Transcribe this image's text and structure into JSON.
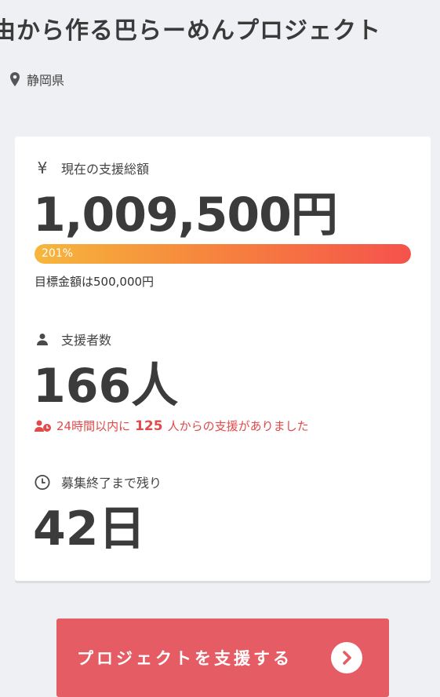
{
  "project": {
    "title": "由から作る巴らーめんプロジェクト",
    "location": "静岡県"
  },
  "stats": {
    "amount_label": "現在の支援総額",
    "amount_value": "1,009,500円",
    "progress_percent_text": "201%",
    "progress_fraction": 1.0,
    "goal_text": "目標金額は500,000円",
    "supporters_label": "支援者数",
    "supporters_value": "166人",
    "recent_prefix": "24時間以内に",
    "recent_count": "125",
    "recent_suffix": "人からの支援がありました",
    "remaining_label": "募集終了まで残り",
    "remaining_value": "42日"
  },
  "cta": {
    "label": "プロジェクトを支援する"
  },
  "icons": {
    "location": "map-pin-icon",
    "amount": "yen-icon",
    "supporters": "person-icon",
    "recent": "person-clock-icon",
    "remaining": "clock-icon",
    "cta": "chevron-right-icon"
  },
  "colors": {
    "accent": "#e65c65",
    "recent_text": "#e14a4a",
    "progress_start": "#f6b73c",
    "progress_end": "#f5524c"
  }
}
